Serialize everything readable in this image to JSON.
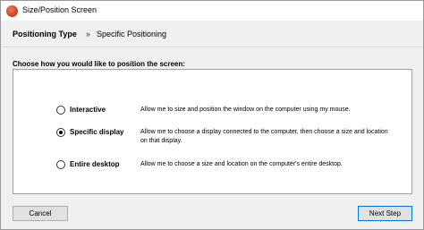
{
  "window": {
    "title": "Size/Position Screen",
    "app_icon": "app-logo-icon"
  },
  "breadcrumb": {
    "parent": "Positioning Type",
    "separator": "»",
    "current": "Specific Positioning"
  },
  "prompt": "Choose how you would like to position the screen:",
  "options": [
    {
      "label": "Interactive",
      "description": "Allow me to size and position the window on the computer using my mouse.",
      "selected": false
    },
    {
      "label": "Specific display",
      "description": "Allow me to choose a display connected to the computer, then choose a size and location on that display.",
      "selected": true
    },
    {
      "label": "Entire desktop",
      "description": "Allow me to choose a size and location on the computer's entire desktop.",
      "selected": false
    }
  ],
  "buttons": {
    "cancel": "Cancel",
    "next": "Next Step"
  }
}
